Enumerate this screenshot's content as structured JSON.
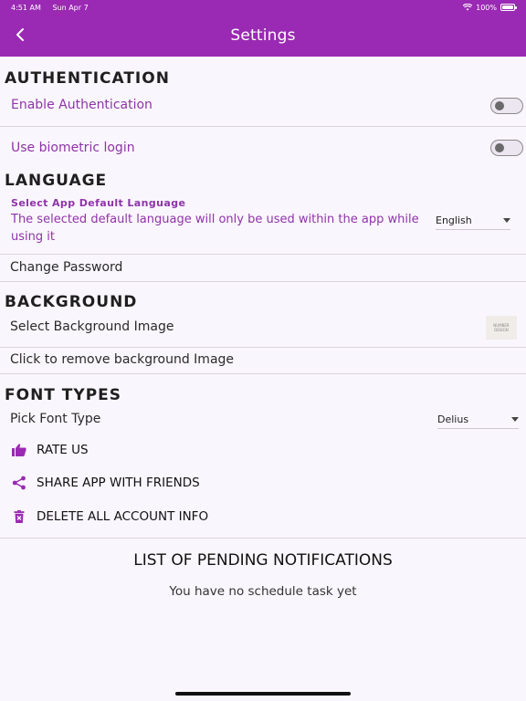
{
  "status_bar": {
    "time": "4:51 AM",
    "date": "Sun Apr 7",
    "battery": "100%"
  },
  "appbar": {
    "title": "Settings"
  },
  "authentication": {
    "heading": "AUTHENTICATION",
    "enable_label": "Enable Authentication",
    "enable_on": false,
    "biometric_label": "Use biometric login",
    "biometric_on": false
  },
  "language": {
    "heading": "LANGUAGE",
    "subtitle": "Select App Default Language",
    "description": "The selected default language will only be used within the app while using it",
    "selected": "English"
  },
  "password": {
    "label": "Change Password"
  },
  "background": {
    "heading": "BACKGROUND",
    "select_label": "Select Background Image",
    "thumb_text": "NUMBER DESIGN",
    "remove_label": "Click to remove background Image"
  },
  "font": {
    "heading": "FONT TYPES",
    "pick_label": "Pick Font Type",
    "selected": "Delius"
  },
  "actions": {
    "rate": "RATE US",
    "share": "SHARE APP WITH FRIENDS",
    "delete": "DELETE ALL ACCOUNT INFO"
  },
  "notifications": {
    "title": "LIST OF PENDING NOTIFICATIONS",
    "empty": "You have no schedule task yet"
  },
  "colors": {
    "accent": "#9a2ab3",
    "text_purple": "#8e34a8",
    "background": "#faf6fd"
  }
}
